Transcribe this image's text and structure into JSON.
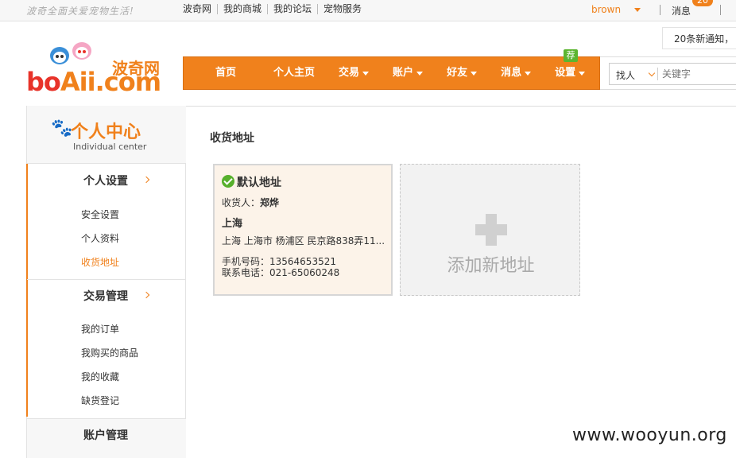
{
  "topbar": {
    "slogan": "波奇全面关爱宠物生活!",
    "links": [
      "波奇网",
      "我的商城",
      "我的论坛",
      "宠物服务"
    ],
    "username": "brown",
    "message_label": "消息",
    "message_count": "20"
  },
  "notice": {
    "text": "20条新通知，"
  },
  "logo": {
    "cn": "波奇网",
    "en_b": "bo",
    "en_rest": "Aii.com"
  },
  "nav": {
    "items": [
      {
        "label": "首页",
        "has_caret": false
      },
      {
        "label": "个人主页",
        "has_caret": false
      },
      {
        "label": "交易",
        "has_caret": true
      },
      {
        "label": "账户",
        "has_caret": true
      },
      {
        "label": "好友",
        "has_caret": true
      },
      {
        "label": "消息",
        "has_caret": true
      },
      {
        "label": "设置",
        "has_caret": true
      }
    ],
    "badge": "荐"
  },
  "search": {
    "type": "找人",
    "placeholder": "关键字"
  },
  "sidebar": {
    "title": "个人中心",
    "subtitle": "Individual center",
    "groups": [
      {
        "title": "个人设置",
        "items": [
          "安全设置",
          "个人资料",
          "收货地址"
        ],
        "active": "收货地址"
      },
      {
        "title": "交易管理",
        "items": [
          "我的订单",
          "我购买的商品",
          "我的收藏",
          "缺货登记"
        ]
      },
      {
        "title": "账户管理",
        "items": []
      }
    ]
  },
  "main": {
    "title": "收货地址",
    "address": {
      "default_label": "默认地址",
      "receiver_label": "收货人：",
      "receiver_name": "郑烨",
      "city": "上海",
      "street": "上海 上海市 杨浦区 民京路838弄11...",
      "mobile": "手机号码：13564653521",
      "phone": "联系电话：021-65060248"
    },
    "add_label": "添加新地址"
  },
  "watermark": "www.wooyun.org",
  "colors": {
    "accent": "#f0811c",
    "success": "#57b02c",
    "card_bg": "#fcf3e9"
  }
}
